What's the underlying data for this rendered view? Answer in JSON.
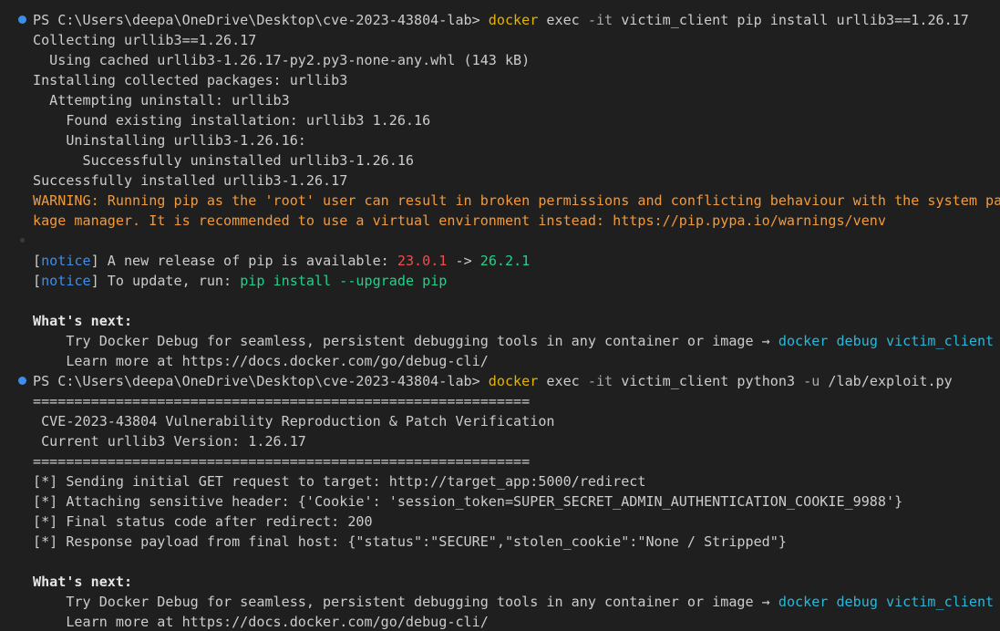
{
  "colors": {
    "background": "#1f1f1f",
    "default_text": "#cccccc",
    "command": "#e5b400",
    "warning": "#f29a3c",
    "notice": "#3b8eea",
    "old_version": "#f14c4c",
    "new_version": "#23d18b",
    "docker_link": "#29b8db",
    "prompt_marker": "#3b8eea"
  },
  "terminal": {
    "lines": [
      {
        "marker": "filled",
        "segments": [
          {
            "text": "PS C:\\Users\\deepa\\OneDrive\\Desktop\\cve-2023-43804-lab> ",
            "style": "default"
          },
          {
            "text": "docker",
            "style": "yellow"
          },
          {
            "text": " exec ",
            "style": "default"
          },
          {
            "text": "-it",
            "style": "dim"
          },
          {
            "text": " victim_client pip install urllib3==1.26.17",
            "style": "default"
          }
        ]
      },
      {
        "segments": [
          {
            "text": "Collecting urllib3==1.26.17",
            "style": "default"
          }
        ]
      },
      {
        "segments": [
          {
            "text": "  Using cached urllib3-1.26.17-py2.py3-none-any.whl (143 kB)",
            "style": "default"
          }
        ]
      },
      {
        "segments": [
          {
            "text": "Installing collected packages: urllib3",
            "style": "default"
          }
        ]
      },
      {
        "segments": [
          {
            "text": "  Attempting uninstall: urllib3",
            "style": "default"
          }
        ]
      },
      {
        "segments": [
          {
            "text": "    Found existing installation: urllib3 1.26.16",
            "style": "default"
          }
        ]
      },
      {
        "segments": [
          {
            "text": "    Uninstalling urllib3-1.26.16:",
            "style": "default"
          }
        ]
      },
      {
        "segments": [
          {
            "text": "      Successfully uninstalled urllib3-1.26.16",
            "style": "default"
          }
        ]
      },
      {
        "segments": [
          {
            "text": "Successfully installed urllib3-1.26.17",
            "style": "default"
          }
        ]
      },
      {
        "segments": [
          {
            "text": "WARNING: Running pip as the 'root' user can result in broken permissions and conflicting behaviour with the system pac",
            "style": "orange"
          }
        ]
      },
      {
        "segments": [
          {
            "text": "kage manager. It is recommended to use a virtual environment instead: https://pip.pypa.io/warnings/venv",
            "style": "orange"
          }
        ]
      },
      {
        "marker": "dim",
        "segments": [
          {
            "text": "",
            "style": "default"
          }
        ]
      },
      {
        "segments": [
          {
            "text": "[",
            "style": "default"
          },
          {
            "text": "notice",
            "style": "blue"
          },
          {
            "text": "] A new release of pip is available: ",
            "style": "default"
          },
          {
            "text": "23.0.1",
            "style": "red"
          },
          {
            "text": " -> ",
            "style": "default"
          },
          {
            "text": "26.2.1",
            "style": "green"
          }
        ]
      },
      {
        "segments": [
          {
            "text": "[",
            "style": "default"
          },
          {
            "text": "notice",
            "style": "blue"
          },
          {
            "text": "] To update, run: ",
            "style": "default"
          },
          {
            "text": "pip install --upgrade pip",
            "style": "green"
          }
        ]
      },
      {
        "segments": [
          {
            "text": "",
            "style": "default"
          }
        ]
      },
      {
        "segments": [
          {
            "text": "What's next:",
            "style": "bold"
          }
        ]
      },
      {
        "segments": [
          {
            "text": "    Try Docker Debug for seamless, persistent debugging tools in any container or image → ",
            "style": "default"
          },
          {
            "text": "docker debug victim_client",
            "style": "cyan"
          }
        ]
      },
      {
        "segments": [
          {
            "text": "    Learn more at https://docs.docker.com/go/debug-cli/",
            "style": "default"
          }
        ]
      },
      {
        "marker": "filled",
        "segments": [
          {
            "text": "PS C:\\Users\\deepa\\OneDrive\\Desktop\\cve-2023-43804-lab> ",
            "style": "default"
          },
          {
            "text": "docker",
            "style": "yellow"
          },
          {
            "text": " exec ",
            "style": "default"
          },
          {
            "text": "-it",
            "style": "dim"
          },
          {
            "text": " victim_client python3 ",
            "style": "default"
          },
          {
            "text": "-u",
            "style": "dim"
          },
          {
            "text": " /lab/exploit.py",
            "style": "default"
          }
        ]
      },
      {
        "segments": [
          {
            "text": "============================================================",
            "style": "default"
          }
        ]
      },
      {
        "segments": [
          {
            "text": " CVE-2023-43804 Vulnerability Reproduction & Patch Verification",
            "style": "default"
          }
        ]
      },
      {
        "segments": [
          {
            "text": " Current urllib3 Version: 1.26.17",
            "style": "default"
          }
        ]
      },
      {
        "segments": [
          {
            "text": "============================================================",
            "style": "default"
          }
        ]
      },
      {
        "segments": [
          {
            "text": "[*] Sending initial GET request to target: http://target_app:5000/redirect",
            "style": "default"
          }
        ]
      },
      {
        "segments": [
          {
            "text": "[*] Attaching sensitive header: {'Cookie': 'session_token=SUPER_SECRET_ADMIN_AUTHENTICATION_COOKIE_9988'}",
            "style": "default"
          }
        ]
      },
      {
        "segments": [
          {
            "text": "[*] Final status code after redirect: 200",
            "style": "default"
          }
        ]
      },
      {
        "segments": [
          {
            "text": "[*] Response payload from final host: {\"status\":\"SECURE\",\"stolen_cookie\":\"None / Stripped\"}",
            "style": "default"
          }
        ]
      },
      {
        "segments": [
          {
            "text": "",
            "style": "default"
          }
        ]
      },
      {
        "segments": [
          {
            "text": "What's next:",
            "style": "bold"
          }
        ]
      },
      {
        "segments": [
          {
            "text": "    Try Docker Debug for seamless, persistent debugging tools in any container or image → ",
            "style": "default"
          },
          {
            "text": "docker debug victim_client",
            "style": "cyan"
          }
        ]
      },
      {
        "segments": [
          {
            "text": "    Learn more at https://docs.docker.com/go/debug-cli/",
            "style": "default"
          }
        ]
      }
    ]
  }
}
